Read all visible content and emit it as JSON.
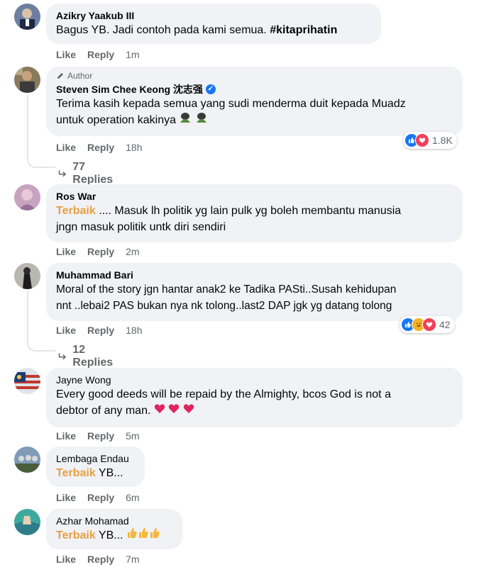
{
  "comments": [
    {
      "name": "Azikry Yaakub III",
      "text_prefix": "Bagus YB. Jadi contoh pada kami semua. ",
      "hashtag": "#kitaprihatin",
      "like": "Like",
      "reply": "Reply",
      "time": "1m",
      "avatar_icon": "user-avatar"
    },
    {
      "author_label": "Author",
      "name": "Steven Sim Chee Keong 沈志强",
      "text_line1": "Terima kasih kepada semua yang sudi menderma duit kepada Muadz",
      "text_line2": "untuk operation kakinya",
      "emoji": [
        "hands-emoji",
        "hands-emoji"
      ],
      "like": "Like",
      "reply": "Reply",
      "time": "18h",
      "reaction_icons": [
        "like-reaction-icon",
        "love-reaction-icon"
      ],
      "reaction_count": "1.8K",
      "replies_label": "77 Replies",
      "avatar_icon": "user-avatar"
    },
    {
      "name": "Ros War",
      "top_label": "Terbaik",
      "text_line1": ".... Masuk lh politik yg lain pulk yg boleh membantu manusia",
      "text_line2": "jngn masuk politik untk diri sendiri",
      "like": "Like",
      "reply": "Reply",
      "time": "2m",
      "avatar_icon": "user-avatar"
    },
    {
      "name": "Muhammad Bari",
      "text_line1": "Moral of the story jgn hantar anak2 ke Tadika PASti..Susah kehidupan",
      "text_line2": "nnt ..lebai2 PAS bukan nya nk tolong..last2 DAP jgk yg datang tolong",
      "like": "Like",
      "reply": "Reply",
      "time": "18h",
      "reaction_icons": [
        "like-reaction-icon",
        "haha-reaction-icon",
        "love-reaction-icon"
      ],
      "reaction_count": "42",
      "replies_label": "12 Replies",
      "avatar_icon": "user-avatar"
    },
    {
      "name": "Jayne Wong",
      "text_line1": "Every good deeds will be repaid by the Almighty, bcos God is not a",
      "text_line2": "debtor of any man.",
      "emoji": [
        "heart-emoji",
        "heart-emoji",
        "heart-emoji"
      ],
      "like": "Like",
      "reply": "Reply",
      "time": "5m",
      "avatar_icon": "user-avatar"
    },
    {
      "name": "Lembaga Endau",
      "top_label": "Terbaik",
      "text_line1": " YB...",
      "like": "Like",
      "reply": "Reply",
      "time": "6m",
      "avatar_icon": "user-avatar"
    },
    {
      "name": "Azhar Mohamad",
      "top_label": "Terbaik",
      "text_line1": " YB...",
      "emoji": [
        "thumbs-up-emoji",
        "thumbs-up-emoji",
        "thumbs-up-emoji"
      ],
      "like": "Like",
      "reply": "Reply",
      "time": "7m",
      "avatar_icon": "user-avatar"
    }
  ],
  "colors": {
    "bubble": "#f0f2f5",
    "meta": "#65676b",
    "top_fan": "#e6a047",
    "verified": "#1877f2",
    "like": "#1877f2",
    "love": "#f33e58",
    "haha": "#f7b125"
  }
}
